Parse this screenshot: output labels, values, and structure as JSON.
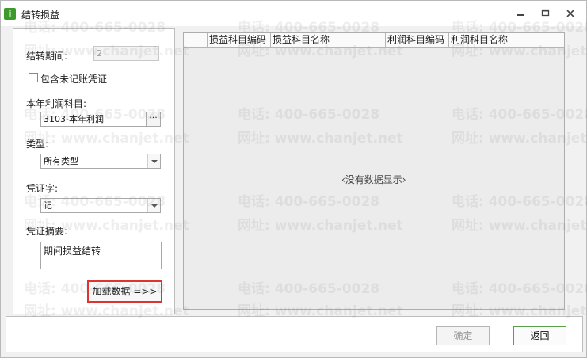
{
  "window": {
    "title": "结转损益",
    "app_icon_glyph": "i"
  },
  "form": {
    "period_label": "结转期间:",
    "period_value": "2",
    "include_unposted_label": "包含未记账凭证",
    "include_unposted_checked": false,
    "profit_account_label": "本年利润科目:",
    "profit_account_value": "3103-本年利润",
    "ellipsis_label": "···",
    "type_label": "类型:",
    "type_value": "所有类型",
    "voucher_word_label": "凭证字:",
    "voucher_word_value": "记",
    "summary_label": "凭证摘要:",
    "summary_value": "期间损益结转",
    "load_button_label": "加载数据 =>>"
  },
  "grid": {
    "columns": [
      "损益科目编码",
      "损益科目名称",
      "利润科目编码",
      "利润科目名称"
    ],
    "rows": [],
    "empty_message": "‹没有数据显示›"
  },
  "footer": {
    "ok_label": "确定",
    "back_label": "返回"
  },
  "watermark": {
    "phone": "电话: 400-665-0028",
    "site": "网址: www.chanjet.net"
  },
  "colors": {
    "app_icon": "#3a9a2a",
    "highlight_border": "#e0322f",
    "back_button_border": "#5aa04a"
  },
  "icons": [
    "app-icon",
    "minimize-icon",
    "maximize-icon",
    "close-icon",
    "dropdown-arrow-icon",
    "ellipsis-icon"
  ]
}
